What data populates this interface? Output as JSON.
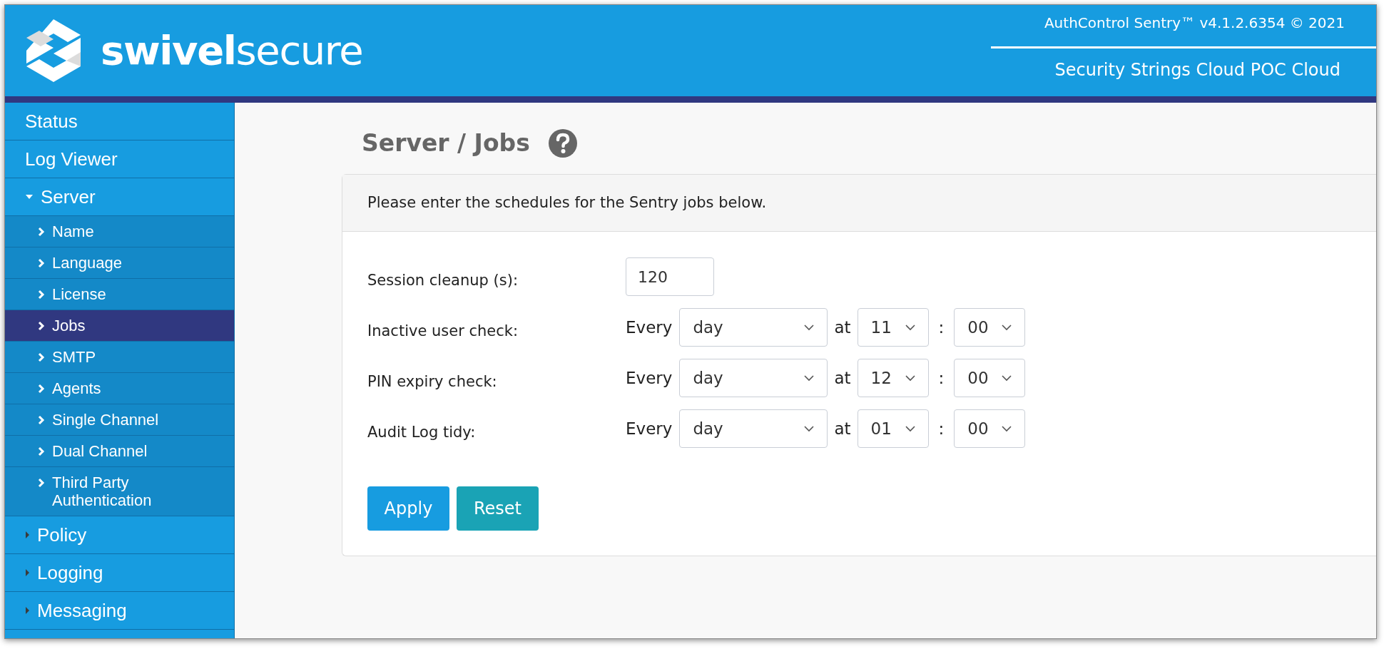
{
  "header": {
    "logo": "**swivel**secure",
    "version": "AuthControl Sentry™ v4.1.2.6354 © 2021",
    "subtitle": "Security Strings Cloud POC Cloud"
  },
  "sidebar": {
    "items": [
      {
        "label": "Status",
        "kind": "top",
        "selected": false
      },
      {
        "label": "Log Viewer",
        "kind": "top",
        "selected": false
      },
      {
        "label": "Server",
        "kind": "group",
        "expanded": true,
        "selected": false,
        "children": [
          {
            "label": "Name",
            "selected": false
          },
          {
            "label": "Language",
            "selected": false
          },
          {
            "label": "License",
            "selected": false
          },
          {
            "label": "Jobs",
            "selected": true
          },
          {
            "label": "SMTP",
            "selected": false
          },
          {
            "label": "Agents",
            "selected": false
          },
          {
            "label": "Single Channel",
            "selected": false
          },
          {
            "label": "Dual Channel",
            "selected": false
          },
          {
            "label": "Third Party Authentication",
            "selected": false
          }
        ]
      },
      {
        "label": "Policy",
        "kind": "group",
        "expanded": false,
        "selected": false
      },
      {
        "label": "Logging",
        "kind": "group",
        "expanded": false,
        "selected": false
      },
      {
        "label": "Messaging",
        "kind": "group",
        "expanded": false,
        "selected": false
      }
    ]
  },
  "page": {
    "title": "Server / Jobs",
    "intro": "Please enter the schedules for the Sentry jobs below.",
    "rows": [
      {
        "kind": "number",
        "label": "Session cleanup (s):",
        "value": "120"
      },
      {
        "kind": "schedule",
        "label": "Inactive user check:",
        "every": "Every",
        "period": "day",
        "at": "at",
        "hour": "11",
        "sep": ":",
        "minute": "00"
      },
      {
        "kind": "schedule",
        "label": "PIN expiry check:",
        "every": "Every",
        "period": "day",
        "at": "at",
        "hour": "12",
        "sep": ":",
        "minute": "00"
      },
      {
        "kind": "schedule",
        "label": "Audit Log tidy:",
        "every": "Every",
        "period": "day",
        "at": "at",
        "hour": "01",
        "sep": ":",
        "minute": "00"
      }
    ],
    "buttons": [
      {
        "label": "Apply",
        "kind": "primary"
      },
      {
        "label": "Reset",
        "kind": "secondary"
      }
    ]
  }
}
